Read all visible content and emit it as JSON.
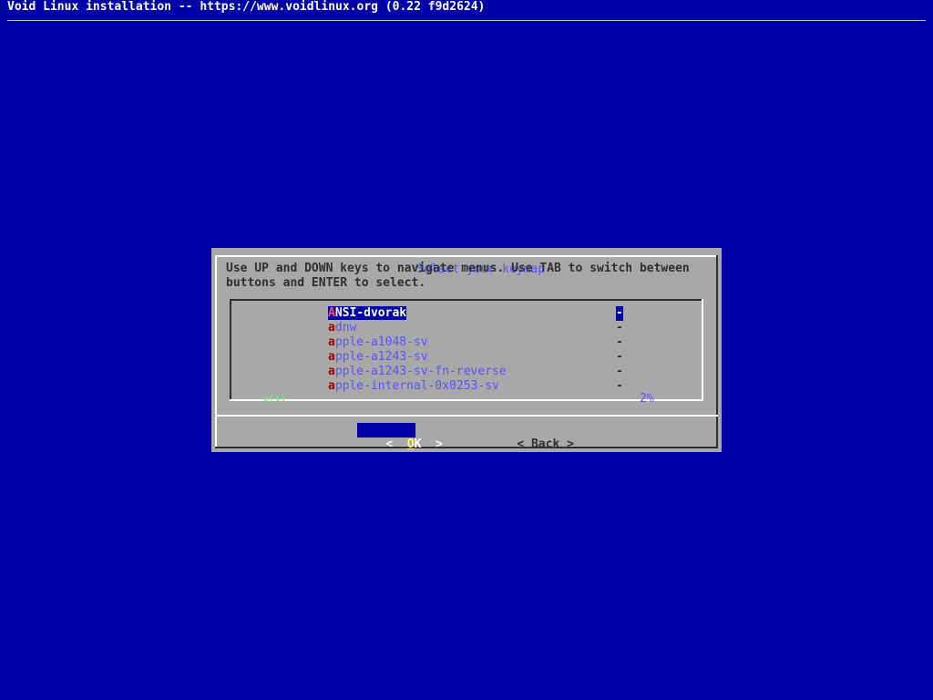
{
  "backtitle": "Void Linux installation -- https://www.voidlinux.org (0.22 f9d2624)",
  "dialog": {
    "title": "Select your keymap",
    "prompt": "Use UP and DOWN keys to navigate menus. Use TAB to switch between\nbuttons and ENTER to select.",
    "menu": {
      "items": [
        {
          "hot": "A",
          "rest": "NSI-dvorak",
          "desc": "-",
          "selected": true
        },
        {
          "hot": "a",
          "rest": "dnw",
          "desc": "-",
          "selected": false
        },
        {
          "hot": "a",
          "rest": "pple-a1048-sv",
          "desc": "-",
          "selected": false
        },
        {
          "hot": "a",
          "rest": "pple-a1243-sv",
          "desc": "-",
          "selected": false
        },
        {
          "hot": "a",
          "rest": "pple-a1243-sv-fn-reverse",
          "desc": "-",
          "selected": false
        },
        {
          "hot": "a",
          "rest": "pple-internal-0x0253-sv",
          "desc": "-",
          "selected": false
        }
      ],
      "scroll_indicator": "v(+)",
      "percent": "2%"
    },
    "buttons": {
      "ok": {
        "left": "<",
        "hot": "O",
        "rest": "K",
        "right": ">"
      },
      "back": {
        "left": "<",
        "label": "Back",
        "right": ">"
      }
    }
  },
  "colors": {
    "background": "#0000a8",
    "dialog": "#a8a8a8",
    "title": "#5555ff",
    "hotkey": "#a80000",
    "selection": "#0000a8"
  }
}
